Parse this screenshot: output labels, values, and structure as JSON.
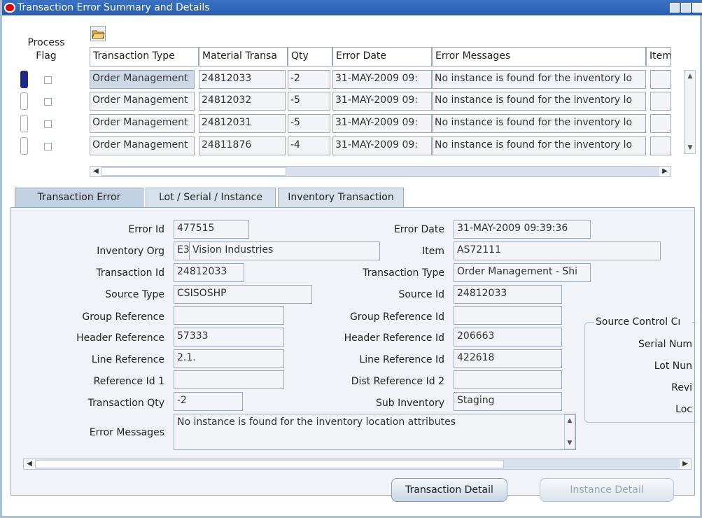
{
  "window": {
    "title": "Transaction Error Summary and Details"
  },
  "table": {
    "process_flag_header": "Process\nFlag",
    "columns": [
      "Transaction Type",
      "Material Transa",
      "Qty",
      "Error Date",
      "Error Messages",
      "Item"
    ],
    "rows": [
      [
        "Order Management",
        "24812033",
        "-2",
        "31-MAY-2009 09:",
        "No instance is found for the inventory lo",
        ""
      ],
      [
        "Order Management",
        "24812032",
        "-5",
        "31-MAY-2009 09:",
        "No instance is found for the inventory lo",
        ""
      ],
      [
        "Order Management",
        "24812031",
        "-5",
        "31-MAY-2009 09:",
        "No instance is found for the inventory lo",
        ""
      ],
      [
        "Order Management",
        "24811876",
        "-4",
        "31-MAY-2009 09:",
        "No instance is found for the inventory lo",
        ""
      ]
    ]
  },
  "tabs": [
    "Transaction Error",
    "Lot / Serial / Instance",
    "Inventory  Transaction"
  ],
  "form": {
    "error_id_label": "Error Id",
    "error_id": "477515",
    "error_date_label": "Error Date",
    "error_date": "31-MAY-2009 09:39:36",
    "inventory_org_label": "Inventory Org",
    "inventory_org_code": "E3",
    "inventory_org_name": "Vision Industries",
    "item_label": "Item",
    "item": "AS72111",
    "transaction_id_label": "Transaction Id",
    "transaction_id": "24812033",
    "transaction_type_label": "Transaction Type",
    "transaction_type": "Order Management - Shi",
    "source_type_label": "Source Type",
    "source_type": "CSISOSHP",
    "source_id_label": "Source Id",
    "source_id": "24812033",
    "group_reference_label": "Group Reference",
    "group_reference": "",
    "group_reference_id_label": "Group Reference Id",
    "group_reference_id": "",
    "header_reference_label": "Header Reference",
    "header_reference": "57333",
    "header_reference_id_label": "Header Reference Id",
    "header_reference_id": "206663",
    "line_reference_label": "Line Reference",
    "line_reference": "2.1.",
    "line_reference_id_label": "Line Reference Id",
    "line_reference_id": "422618",
    "reference_id_1_label": "Reference Id 1",
    "reference_id_1": "",
    "dist_reference_id_2_label": "Dist Reference Id 2",
    "dist_reference_id_2": "",
    "transaction_qty_label": "Transaction Qty",
    "transaction_qty": "-2",
    "sub_inventory_label": "Sub Inventory",
    "sub_inventory": "Staging",
    "error_messages_label": "Error Messages",
    "error_messages": "No instance is found for the inventory location attributes"
  },
  "source_control": {
    "title": "Source Control Cı",
    "serial": "Serial Num",
    "lot": "Lot Nun",
    "revision": "Revi",
    "locator": "Loc"
  },
  "buttons": {
    "transaction_detail": "Transaction Detail",
    "instance_detail": "Instance Detail"
  }
}
